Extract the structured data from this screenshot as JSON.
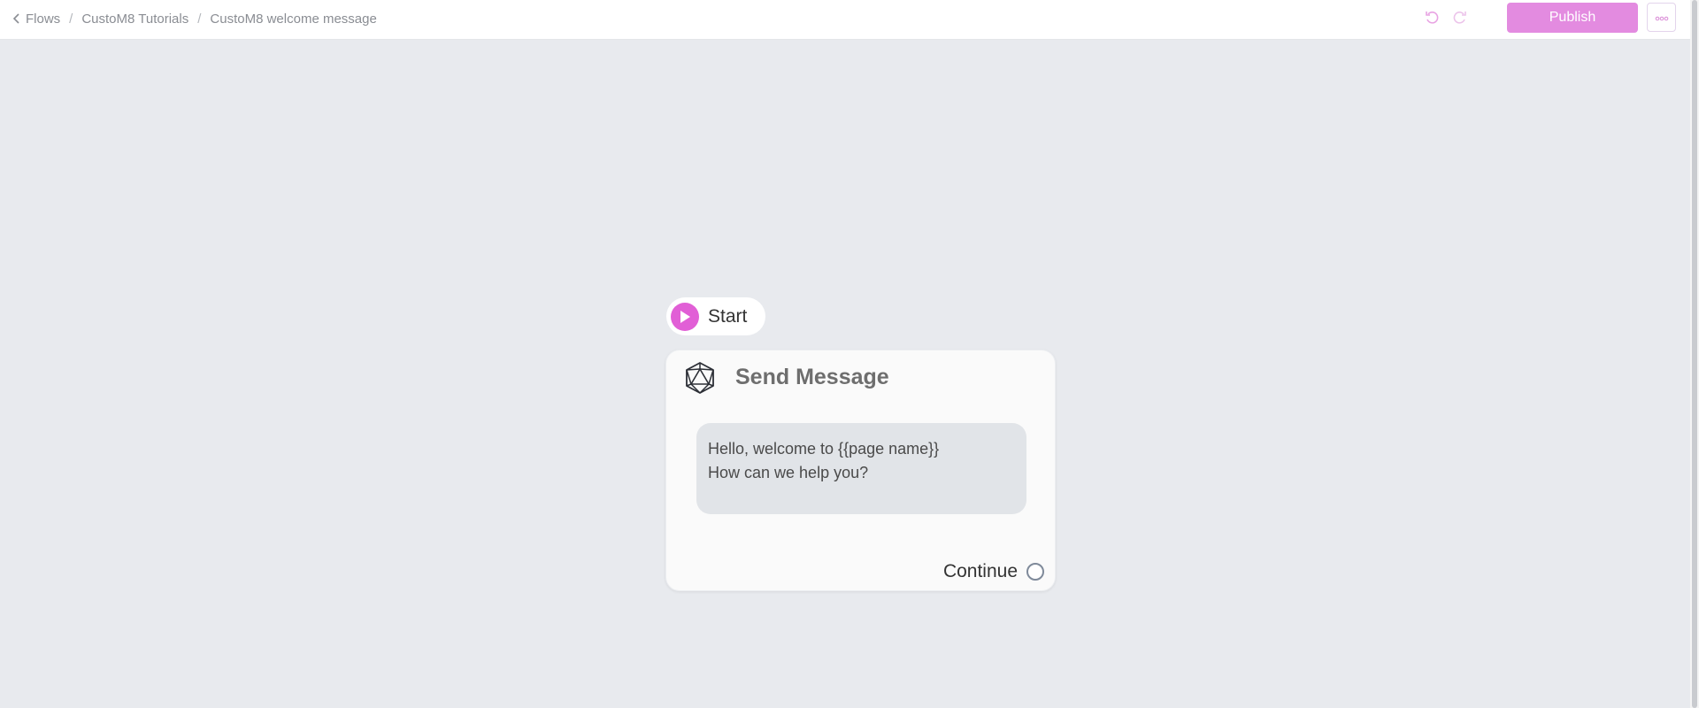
{
  "breadcrumb": {
    "back_icon": "chevron-left-icon",
    "items": [
      "Flows",
      "CustoM8 Tutorials",
      "CustoM8 welcome message"
    ],
    "separator": "/"
  },
  "toolbar": {
    "undo_icon": "undo-icon",
    "redo_icon": "redo-icon",
    "publish_label": "Publish",
    "more_icon": "more-horizontal-icon"
  },
  "canvas": {
    "start_node": {
      "label": "Start",
      "icon": "play-icon"
    },
    "send_message_node": {
      "title": "Send Message",
      "icon": "icosahedron-icon",
      "message_lines": [
        "Hello, welcome to {{page name}}",
        "How can we help you?"
      ],
      "continue_label": "Continue"
    }
  },
  "colors": {
    "accent": "#e15fd6",
    "publish_bg": "#e38be0",
    "canvas_bg": "#e8eaee",
    "bubble_bg": "#e1e4e8"
  }
}
